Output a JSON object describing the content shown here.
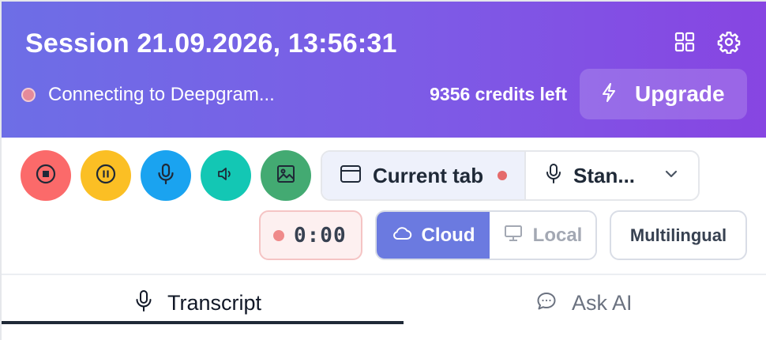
{
  "header": {
    "title": "Session 21.09.2026, 13:56:31",
    "status_text": "Connecting to Deepgram...",
    "credits_text": "9356 credits left",
    "upgrade_label": "Upgrade",
    "icons": [
      "grid-icon",
      "gear-icon",
      "lightning-icon"
    ]
  },
  "controls": {
    "buttons": [
      {
        "name": "stop",
        "icon": "stop-icon",
        "color": "#fb6a6a"
      },
      {
        "name": "pause",
        "icon": "pause-icon",
        "color": "#fbbf24"
      },
      {
        "name": "microphone",
        "icon": "microphone-icon",
        "color": "#1aa3f0"
      },
      {
        "name": "speaker",
        "icon": "speaker-icon",
        "color": "#13c7b4"
      },
      {
        "name": "image",
        "icon": "image-icon",
        "color": "#43aa72"
      }
    ],
    "source_tab_label": "Current tab",
    "mic_select_label": "Stan...",
    "timer": "0:00",
    "mode_cloud_label": "Cloud",
    "mode_local_label": "Local",
    "language_label": "Multilingual"
  },
  "tabs": [
    {
      "label": "Transcript",
      "icon": "microphone-icon",
      "active": true
    },
    {
      "label": "Ask AI",
      "icon": "chat-bubble-icon",
      "active": false
    }
  ],
  "colors": {
    "header_gradient_start": "#6d6ee6",
    "header_gradient_end": "#8745e2",
    "cloud_active": "#6b7ae0",
    "recording_dot": "#e56b6b"
  }
}
